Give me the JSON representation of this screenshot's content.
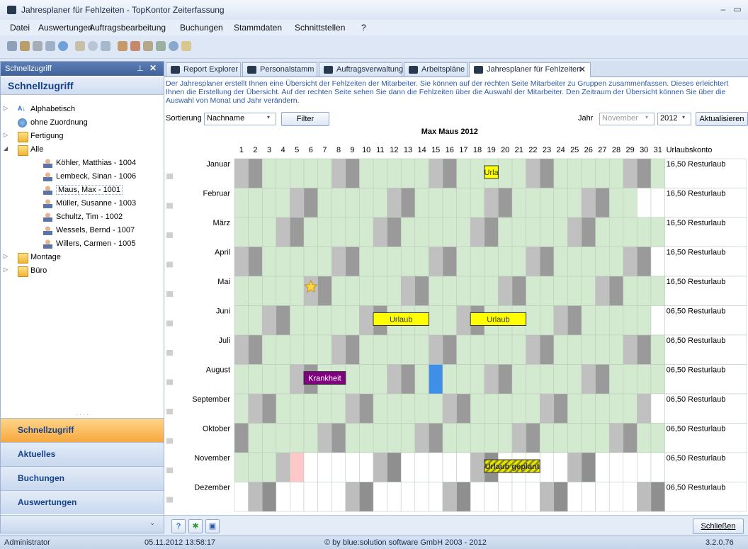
{
  "window": {
    "title": "Jahresplaner für Fehlzeiten - TopKontor Zeiterfassung"
  },
  "menu": [
    "Datei",
    "Auswertungen",
    "Auftragsbearbeitung",
    "Buchungen",
    "Stammdaten",
    "Schnittstellen",
    "?"
  ],
  "left_panel": {
    "header": "Schnellzugriff",
    "title": "Schnellzugriff",
    "tree": [
      {
        "label": "Alphabetisch",
        "icon": "az-icon",
        "level": 0,
        "twisty": "▷"
      },
      {
        "label": "ohne Zuordnung",
        "icon": "globe-icon",
        "level": 0,
        "twisty": ""
      },
      {
        "label": "Fertigung",
        "icon": "folder-icon",
        "level": 0,
        "twisty": "▷"
      },
      {
        "label": "Alle",
        "icon": "folder-icon",
        "level": 0,
        "twisty": "◢"
      },
      {
        "label": "Köhler, Matthias - 1004",
        "icon": "person-icon",
        "level": 1,
        "twisty": ""
      },
      {
        "label": "Lembeck, Sinan - 1006",
        "icon": "person-icon",
        "level": 1,
        "twisty": ""
      },
      {
        "label": "Maus, Max - 1001",
        "icon": "person-icon",
        "level": 1,
        "twisty": "",
        "selected": true
      },
      {
        "label": "Müller, Susanne - 1003",
        "icon": "person-icon",
        "level": 1,
        "twisty": ""
      },
      {
        "label": "Schultz, Tim - 1002",
        "icon": "person-icon",
        "level": 1,
        "twisty": ""
      },
      {
        "label": "Wessels, Bernd - 1007",
        "icon": "person-icon",
        "level": 1,
        "twisty": ""
      },
      {
        "label": "Willers, Carmen - 1005",
        "icon": "person-icon",
        "level": 1,
        "twisty": ""
      },
      {
        "label": "Montage",
        "icon": "folder-icon",
        "level": 0,
        "twisty": "▷"
      },
      {
        "label": "Büro",
        "icon": "folder-icon",
        "level": 0,
        "twisty": "▷"
      }
    ],
    "nav_buttons": [
      {
        "label": "Schnellzugriff",
        "active": true
      },
      {
        "label": "Aktuelles",
        "active": false
      },
      {
        "label": "Buchungen",
        "active": false
      },
      {
        "label": "Auswertungen",
        "active": false
      }
    ]
  },
  "tabs": [
    {
      "label": "Report Explorer",
      "active": false
    },
    {
      "label": "Personalstamm",
      "active": false
    },
    {
      "label": "Auftragsverwaltung",
      "active": false
    },
    {
      "label": "Arbeitspläne",
      "active": false
    },
    {
      "label": "Jahresplaner für Fehlzeiten",
      "active": true
    }
  ],
  "info_text": "Der Jahresplaner erstellt Ihnen eine Übersicht der Fehlzeiten der Mitarbeiter. Sie können auf der rechten Seite Mitarbeiter zu Gruppen zusammenfassen. Dieses erleichtert Ihnen die Erstellung der Übersicht. Auf der rechten Seite sehen Sie dann die Fehlzeiten über die Auswahl der Mitarbeiter. Den Zeitraum der Übersicht können Sie über die Auswahl von Monat und Jahr verändern.",
  "controls": {
    "sort_label": "Sortierung",
    "sort_value": "Nachname",
    "filter_label": "Filter",
    "year_label": "Jahr",
    "month_value": "November",
    "year_value": "2012",
    "refresh_label": "Aktualisieren"
  },
  "planner": {
    "title": "Max Maus 2012",
    "konto_header": "Urlaubskonto",
    "days": [
      "1",
      "2",
      "3",
      "4",
      "5",
      "6",
      "7",
      "8",
      "9",
      "10",
      "11",
      "12",
      "13",
      "14",
      "15",
      "16",
      "17",
      "18",
      "19",
      "20",
      "21",
      "22",
      "23",
      "24",
      "25",
      "26",
      "27",
      "28",
      "29",
      "30",
      "31"
    ],
    "months": [
      {
        "name": "Januar",
        "konto": "16,50 Resturlaub",
        "dim": 31,
        "first_wd": 6
      },
      {
        "name": "Februar",
        "konto": "16,50 Resturlaub",
        "dim": 29,
        "first_wd": 2
      },
      {
        "name": "März",
        "konto": "16,50 Resturlaub",
        "dim": 31,
        "first_wd": 3
      },
      {
        "name": "April",
        "konto": "16,50 Resturlaub",
        "dim": 30,
        "first_wd": 6
      },
      {
        "name": "Mai",
        "konto": "16,50 Resturlaub",
        "dim": 31,
        "first_wd": 1
      },
      {
        "name": "Juni",
        "konto": "06,50 Resturlaub",
        "dim": 30,
        "first_wd": 4
      },
      {
        "name": "Juli",
        "konto": "06,50 Resturlaub",
        "dim": 31,
        "first_wd": 6
      },
      {
        "name": "August",
        "konto": "06,50 Resturlaub",
        "dim": 31,
        "first_wd": 2
      },
      {
        "name": "September",
        "konto": "06,50 Resturlaub",
        "dim": 30,
        "first_wd": 5
      },
      {
        "name": "Oktober",
        "konto": "06,50 Resturlaub",
        "dim": 31,
        "first_wd": 0
      },
      {
        "name": "November",
        "konto": "06,50 Resturlaub",
        "dim": 30,
        "first_wd": 3
      },
      {
        "name": "Dezember",
        "konto": "06,50 Resturlaub",
        "dim": 31,
        "first_wd": 5
      }
    ],
    "today": {
      "month": 10,
      "day": 5
    },
    "future_from": {
      "month": 10,
      "day": 6
    },
    "events": [
      {
        "month": 0,
        "start": 19,
        "end": 20,
        "label": "Urla",
        "color": "#ffff00",
        "pattern": false
      },
      {
        "month": 5,
        "start": 11,
        "end": 15,
        "label": "Urlaub",
        "color": "#ffff00",
        "pattern": false
      },
      {
        "month": 5,
        "start": 18,
        "end": 22,
        "label": "Urlaub",
        "color": "#ffff00",
        "pattern": false
      },
      {
        "month": 7,
        "start": 6,
        "end": 9,
        "label": "Krankheit",
        "color": "#800080",
        "pattern": false
      },
      {
        "month": 10,
        "start": 19,
        "end": 23,
        "label": "Urlaub geplant",
        "color": "#e6e600",
        "pattern": true
      }
    ],
    "star": {
      "month": 4,
      "day": 6
    },
    "blue_cell": {
      "month": 7,
      "day": 15,
      "color": "#3f8fe8"
    }
  },
  "footer": {
    "close_label": "Schließen"
  },
  "status": {
    "user": "Administrator",
    "datetime": "05.11.2012 13:58:17",
    "copyright": "© by blue:solution software GmbH 2003 - 2012",
    "version": "3.2.0.76"
  },
  "colors": {
    "workday": "#d4ead0",
    "weekend_sat": "#c0c0c0",
    "weekend_sun": "#9a9a9a",
    "future": "#ffffff",
    "today": "#ffc8c8"
  }
}
